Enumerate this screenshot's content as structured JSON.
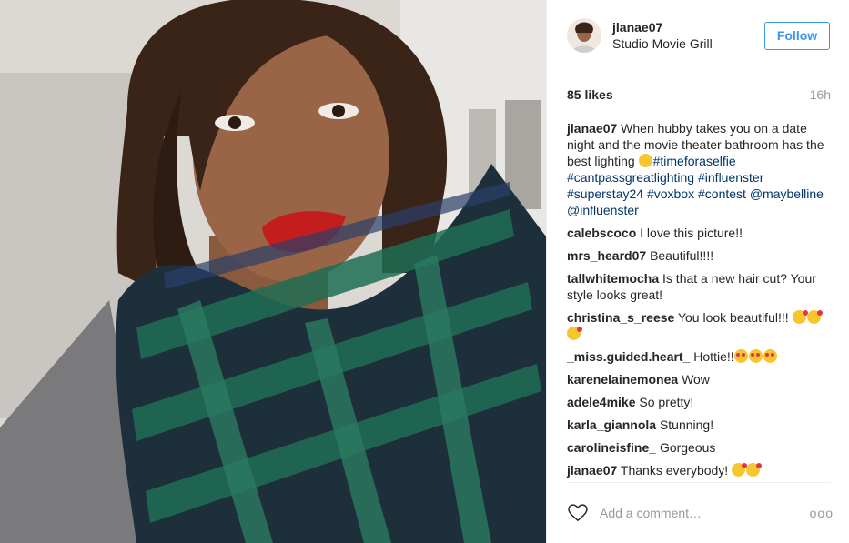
{
  "photo": {
    "alt_icon": "selfie-photo"
  },
  "header": {
    "username": "jlanae07",
    "location": "Studio Movie Grill",
    "follow_label": "Follow"
  },
  "stats": {
    "likes": "85 likes",
    "time": "16h"
  },
  "caption": {
    "user": "jlanae07",
    "text": "When hubby takes you on a date night and the movie theater bathroom has the best lighting",
    "tags": [
      "#timeforaselfie",
      "#cantpassgreatlighting",
      "#influenster",
      "#superstay24",
      "#voxbox",
      "#contest",
      "@maybelline",
      "@influenster"
    ]
  },
  "comments": [
    {
      "user": "calebscoco",
      "text": "I love this picture!!"
    },
    {
      "user": "mrs_heard07",
      "text": "Beautiful!!!!"
    },
    {
      "user": "tallwhitemocha",
      "text": "Is that a new hair cut? Your style looks great!"
    },
    {
      "user": "christina_s_reese",
      "text": "You look beautiful!!!"
    },
    {
      "user": "_miss.guided.heart_",
      "text": "Hottie!!"
    },
    {
      "user": "karenelainemonea",
      "text": "Wow"
    },
    {
      "user": "adele4mike",
      "text": "So pretty!"
    },
    {
      "user": "karla_giannola",
      "text": "Stunning!"
    },
    {
      "user": "carolineisfine_",
      "text": "Gorgeous"
    },
    {
      "user": "jlanae07",
      "text": "Thanks everybody!"
    }
  ],
  "footer": {
    "placeholder": "Add a comment…",
    "more": "ooo"
  },
  "colors": {
    "accent": "#3897f0",
    "tag": "#003569",
    "muted": "#999999"
  }
}
